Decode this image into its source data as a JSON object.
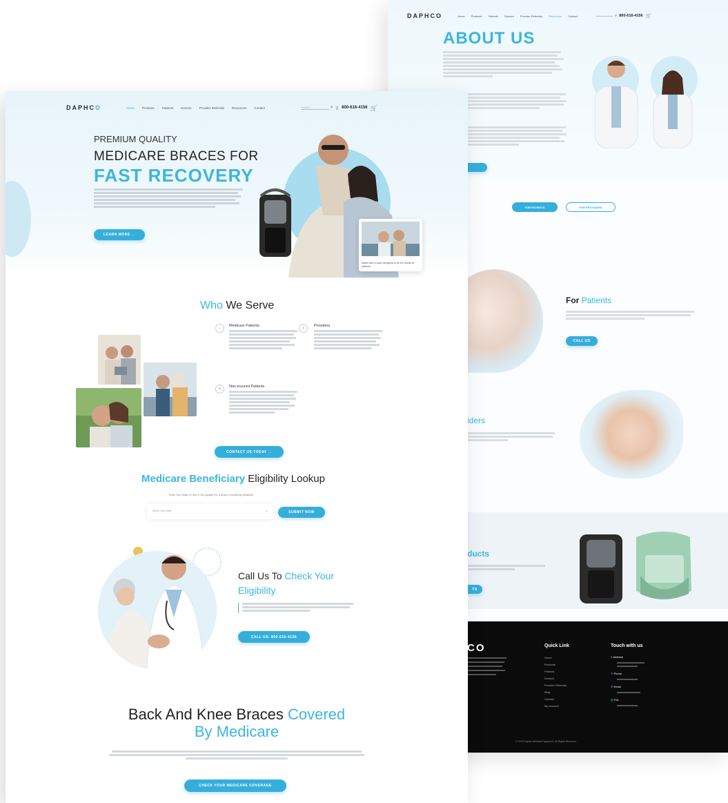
{
  "back": {
    "logo": "DAPHCO",
    "nav": [
      "Home",
      "Products",
      "Patients",
      "Doctors",
      "Provider Referrals",
      "Resources",
      "Contact"
    ],
    "phone": "800-616-4156",
    "about_title": "ABOUT US",
    "tabs": {
      "patients": "FOR PATIENTS",
      "providers": "FOR PROVIDERS"
    },
    "for_patients": {
      "title_a": "For",
      "title_b": "Patients",
      "button": "CALL US"
    },
    "providers_fragment": "iders",
    "products_fragment": "ducts",
    "products_button_fragment": "TS",
    "footer": {
      "logo_fragment": "CO",
      "quick_link_title": "Quick Link",
      "quick_links": [
        "Home",
        "Products",
        "Patients",
        "Doctors",
        "Provider Referrals",
        "Blog",
        "Contact",
        "My Account"
      ],
      "touch_title": "Touch with us",
      "address_label": "Address",
      "phone_label": "Phone",
      "email_label": "Email",
      "fax_label": "Fax",
      "copyright": "© 2023 Daphco Medical Equipment. All Rights Reserved."
    }
  },
  "front": {
    "logo_a": "DAPHC",
    "logo_b": "O",
    "nav": [
      "Home",
      "Products",
      "Patients",
      "Doctors",
      "Provider Referrals",
      "Resources",
      "Contact"
    ],
    "search_placeholder": "Search",
    "phone": "800-616-4156",
    "hero": {
      "line1": "PREMIUM QUALITY",
      "line2": "MEDICARE BRACES FOR",
      "line3": "FAST RECOVERY",
      "button": "LEARN MORE →",
      "card_caption": "Made with a back designed to fit the needs of patients."
    },
    "who": {
      "title_a": "Who",
      "title_b": "We Serve",
      "items": [
        {
          "title": "Medicare Patients"
        },
        {
          "title": "Providers"
        },
        {
          "title": "Non-insured Patients"
        }
      ],
      "button": "CONTACT US TODAY →"
    },
    "eligibility": {
      "title_a": "Medicare Beneficiary",
      "title_b": "Eligibility Lookup",
      "subtitle": "Enter Your State To See If You Qualify For A Brace Covered By Medicare",
      "select_placeholder": "Select Your State",
      "button": "SUBMIT NOW"
    },
    "call": {
      "title_a": "Call Us To",
      "title_b": "Check Your",
      "title_c": "Eligibility",
      "button": "CALL US: 800-616-4156"
    },
    "braces": {
      "title_a": "Back And Knee Braces",
      "title_b": "Covered",
      "title_c": "By Medicare",
      "button": "CHECK YOUR MEDICARE COVERAGE"
    }
  },
  "colors": {
    "accent": "#3bb6e0",
    "footer": "#0b0b0b",
    "hero_bg": "#e7f4fa"
  }
}
